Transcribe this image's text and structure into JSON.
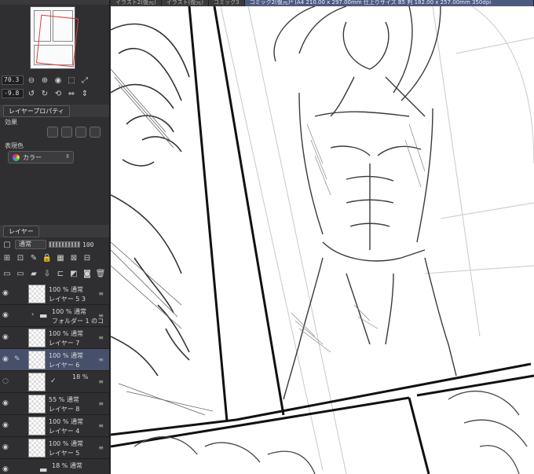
{
  "document_tabs": [
    {
      "label": "イラスト2(復元)"
    },
    {
      "label": "イラスト(復元)"
    },
    {
      "label": "コミック3"
    },
    {
      "label": "コミック2(復元)* (A4 210.00 x 297.00mm 仕上りサイズ B5 判 182.00 x 257.00mm 350dpi"
    }
  ],
  "navigator": {
    "zoom": "70.3",
    "rotation": "-9.8"
  },
  "layer_property": {
    "tab_label": "レイヤープロパティ",
    "effect_label": "効果",
    "expression_color_label": "表現色",
    "expression_color_value": "カラー"
  },
  "layer_panel": {
    "tab_label": "レイヤー",
    "blend_mode": "通常",
    "opacity": "100",
    "layers": [
      {
        "line1": "100 % 通常",
        "line2": "レイヤー 5 3",
        "type": "raster"
      },
      {
        "line1": "100 % 通常",
        "line2": "フォルダー 1 のコ",
        "type": "folder"
      },
      {
        "line1": "100 % 通常",
        "line2": "レイヤー 7",
        "type": "raster"
      },
      {
        "line1": "100 % 通常",
        "line2": "レイヤー 6",
        "type": "raster",
        "selected": true
      },
      {
        "line1": "18 %",
        "line2": "",
        "type": "mask"
      },
      {
        "line1": "55 % 通常",
        "line2": "レイヤー 8",
        "type": "raster"
      },
      {
        "line1": "100 % 通常",
        "line2": "レイヤー 4",
        "type": "raster"
      },
      {
        "line1": "100 % 通常",
        "line2": "レイヤー 5",
        "type": "raster"
      },
      {
        "line1": "18 % 通常",
        "line2": "",
        "type": "folder"
      }
    ]
  },
  "colors": {
    "panel_bg": "#2f2f31",
    "selection": "#47506a",
    "active_tab": "#4d5a80"
  }
}
